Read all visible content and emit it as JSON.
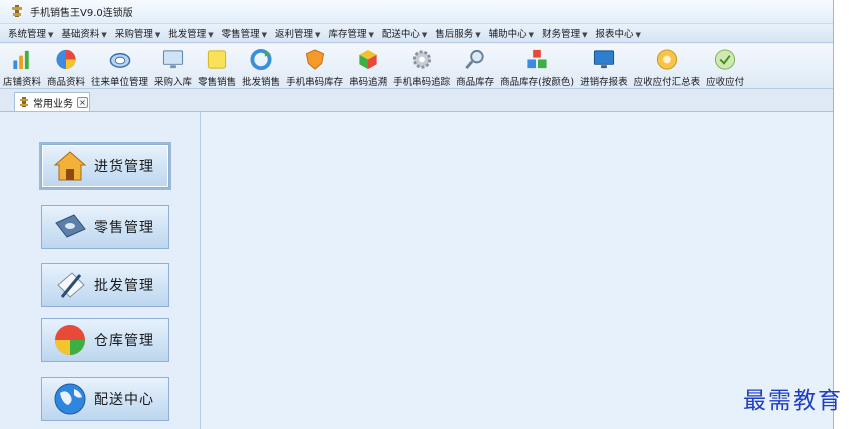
{
  "window": {
    "title": "手机销售王V9.0连锁版"
  },
  "menu": [
    {
      "label": "系统管理"
    },
    {
      "label": "基础资料"
    },
    {
      "label": "采购管理"
    },
    {
      "label": "批发管理"
    },
    {
      "label": "零售管理"
    },
    {
      "label": "返利管理"
    },
    {
      "label": "库存管理"
    },
    {
      "label": "配送中心"
    },
    {
      "label": "售后服务"
    },
    {
      "label": "辅助中心"
    },
    {
      "label": "财务管理"
    },
    {
      "label": "报表中心"
    }
  ],
  "menu_arrow": "▼",
  "toolbar": [
    {
      "label": "店铺资料",
      "icon": "bar-chart-icon"
    },
    {
      "label": "商品资料",
      "icon": "pie-chart-icon"
    },
    {
      "label": "往来单位管理",
      "icon": "dial-icon"
    },
    {
      "label": "采购入库",
      "icon": "monitor-icon"
    },
    {
      "label": "零售销售",
      "icon": "note-icon"
    },
    {
      "label": "批发销售",
      "icon": "refresh-icon"
    },
    {
      "label": "手机串码库存",
      "icon": "shield-icon"
    },
    {
      "label": "串码追溯",
      "icon": "cube-icon"
    },
    {
      "label": "手机串码追踪",
      "icon": "gear-icon"
    },
    {
      "label": "商品库存",
      "icon": "magnifier-icon"
    },
    {
      "label": "商品库存(按颜色)",
      "icon": "blocks-icon"
    },
    {
      "label": "进销存报表",
      "icon": "display-icon"
    },
    {
      "label": "应收应付汇总表",
      "icon": "disc-icon"
    },
    {
      "label": "应收应付",
      "icon": "check-icon"
    }
  ],
  "tab": {
    "label": "常用业务",
    "close": "×"
  },
  "business_buttons": [
    {
      "label": "进货管理",
      "icon": "house-icon"
    },
    {
      "label": "零售管理",
      "icon": "card-icon"
    },
    {
      "label": "批发管理",
      "icon": "pen-note-icon"
    },
    {
      "label": "仓库管理",
      "icon": "pie-icon"
    },
    {
      "label": "配送中心",
      "icon": "globe-icon"
    }
  ],
  "watermark": "最需教育"
}
